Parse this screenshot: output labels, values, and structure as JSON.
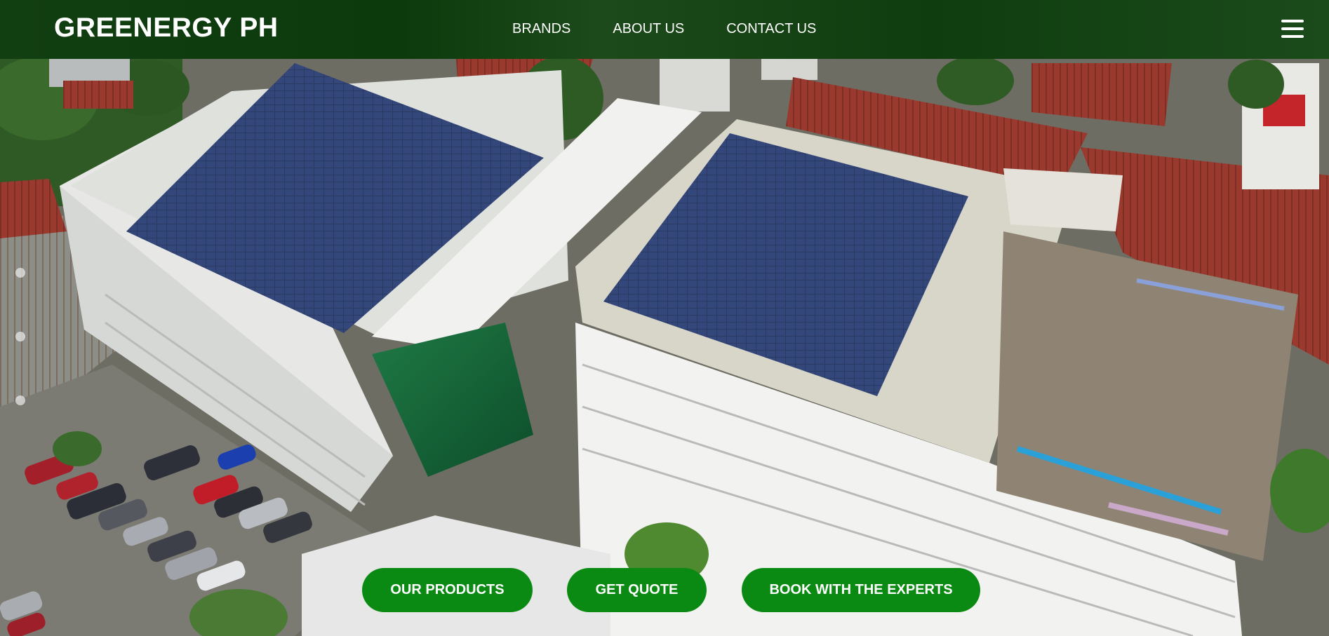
{
  "header": {
    "brand": "GREENERGY PH",
    "nav": [
      "BRANDS",
      "ABOUT US",
      "CONTACT US"
    ],
    "menu_icon": "hamburger-menu-icon"
  },
  "hero": {
    "image": "aerial photo of white multi-storey building with rooftop solar panel arrays",
    "carousel_dots": 3
  },
  "cta": {
    "products": "OUR PRODUCTS",
    "quote": "GET QUOTE",
    "book": "BOOK WITH THE EXPERTS"
  },
  "colors": {
    "header_bg": "#0f3d0f",
    "cta_bg": "#0a8a12",
    "text": "#ffffff"
  }
}
